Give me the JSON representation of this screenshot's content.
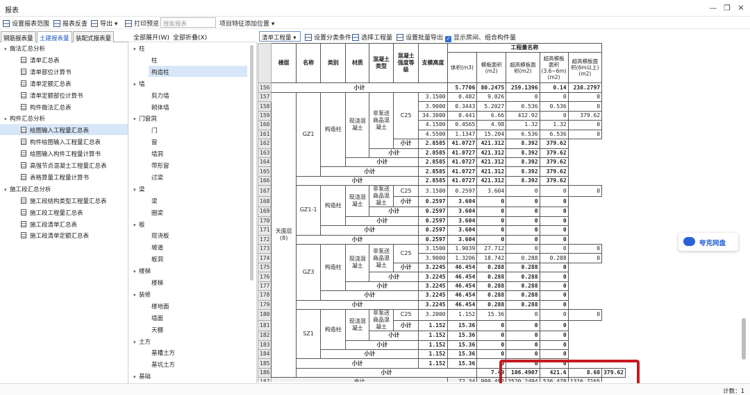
{
  "window": {
    "title": "报表"
  },
  "toolbar": {
    "set_range": "设置报表范围",
    "reverse_check": "报表反查",
    "export": "导出",
    "print_preview": "打印预览",
    "search_placeholder": "搜索报表",
    "add_position": "项目特征添加位置"
  },
  "left_tabs": [
    {
      "label": "钢筋报表量",
      "active": false
    },
    {
      "label": "土建报表量",
      "active": true
    },
    {
      "label": "装配式报表量",
      "active": false
    }
  ],
  "left_tree": [
    {
      "label": "做法汇总分析",
      "level": 0
    },
    {
      "label": "清单汇总表",
      "level": 1
    },
    {
      "label": "清单部位计算书",
      "level": 1
    },
    {
      "label": "清单定额汇总表",
      "level": 1
    },
    {
      "label": "清单定额部位计算书",
      "level": 1
    },
    {
      "label": "构件做法汇总表",
      "level": 1
    },
    {
      "label": "构件汇总分析",
      "level": 0
    },
    {
      "label": "绘图输入工程量汇总表",
      "level": 1,
      "selected": true
    },
    {
      "label": "构件绘图输入工程量汇总表",
      "level": 1
    },
    {
      "label": "绘图输入构件工程量计算书",
      "level": 1
    },
    {
      "label": "高强节点混凝土工程量汇总表",
      "level": 1
    },
    {
      "label": "表格算量工程量计算书",
      "level": 1
    },
    {
      "label": "施工段汇总分析",
      "level": 0
    },
    {
      "label": "施工段结构类型工程量汇总表",
      "level": 1
    },
    {
      "label": "施工段工程量汇总表",
      "level": 1
    },
    {
      "label": "施工段清单汇总表",
      "level": 1
    },
    {
      "label": "施工段清单定额汇总表",
      "level": 1
    }
  ],
  "mid_header": {
    "expand_all": "全部展开(W)",
    "collapse_all": "全部折叠(X)"
  },
  "mid_tree": [
    {
      "label": "柱",
      "level": 0
    },
    {
      "label": "柱",
      "level": 1
    },
    {
      "label": "构造柱",
      "level": 1,
      "selected": true
    },
    {
      "label": "墙",
      "level": 0
    },
    {
      "label": "剪力墙",
      "level": 1
    },
    {
      "label": "砌体墙",
      "level": 1
    },
    {
      "label": "门窗洞",
      "level": 0
    },
    {
      "label": "门",
      "level": 1
    },
    {
      "label": "窗",
      "level": 1
    },
    {
      "label": "墙洞",
      "level": 1
    },
    {
      "label": "带形窗",
      "level": 1
    },
    {
      "label": "过梁",
      "level": 1
    },
    {
      "label": "梁",
      "level": 0
    },
    {
      "label": "梁",
      "level": 1
    },
    {
      "label": "圈梁",
      "level": 1
    },
    {
      "label": "板",
      "level": 0
    },
    {
      "label": "现浇板",
      "level": 1
    },
    {
      "label": "坡道",
      "level": 1
    },
    {
      "label": "板洞",
      "level": 1
    },
    {
      "label": "楼梯",
      "level": 0
    },
    {
      "label": "楼梯",
      "level": 1
    },
    {
      "label": "装修",
      "level": 0
    },
    {
      "label": "楼地面",
      "level": 1
    },
    {
      "label": "墙面",
      "level": 1
    },
    {
      "label": "天棚",
      "level": 1
    },
    {
      "label": "土方",
      "level": 0
    },
    {
      "label": "基槽土方",
      "level": 1
    },
    {
      "label": "基坑土方",
      "level": 1
    },
    {
      "label": "基础",
      "level": 0
    }
  ],
  "right_toolbar": {
    "dropdown": "清单工程量",
    "set_classify": "设置分类条件",
    "select_qty": "选择工程量",
    "batch_export": "设置批量导出",
    "show_rooms": "显示房间、组合构件量"
  },
  "table": {
    "headers": {
      "floor": "楼层",
      "name": "名称",
      "category": "类别",
      "material": "材质",
      "concrete_type": "混凝土类型",
      "concrete_grade": "混凝土强度等级",
      "support_height": "支模高度",
      "qty_group": "工程量名称",
      "volume": "体积(m3)",
      "formwork": "模板面积(m2)",
      "over_formwork": "超高模板面积(m2)",
      "over_formwork_36": "超高模板面积(3.6~6m)(m2)",
      "over_formwork_6": "超高模板面积(6m以上)(m2)"
    },
    "floor_value": "天面层(8)",
    "subtotal": "小计",
    "total": "合计",
    "row_156": {
      "num": "156",
      "vals": [
        "5.7706",
        "80.2475",
        "259.1396",
        "0.14",
        "238.2797"
      ]
    },
    "gz1": {
      "name": "GZ1",
      "category": "构造柱",
      "material": "现浇混凝土",
      "ctype": "非泵送商品混凝土",
      "grade": "C25",
      "rows": [
        {
          "num": "157",
          "h": "3.1500",
          "vals": [
            "0.482",
            "9.026",
            "0",
            "0",
            "0"
          ]
        },
        {
          "num": "158",
          "h": "3.9000",
          "vals": [
            "0.3443",
            "5.2027",
            "0.536",
            "0.536",
            "0"
          ]
        },
        {
          "num": "159",
          "h": "34.3000",
          "vals": [
            "0.441",
            "6.66",
            "412.92",
            "0",
            "379.62"
          ]
        },
        {
          "num": "160",
          "h": "4.1500",
          "vals": [
            "0.4565",
            "4.98",
            "1.32",
            "1.32",
            "0"
          ]
        },
        {
          "num": "161",
          "h": "4.5500",
          "vals": [
            "1.1347",
            "15.204",
            "6.536",
            "6.536",
            "0"
          ]
        }
      ],
      "sub": [
        "2.8585",
        "41.0727",
        "421.312",
        "8.392",
        "379.62"
      ]
    },
    "gz1_1": {
      "name": "GZ1-1",
      "category": "构造柱",
      "material": "现浇混凝土",
      "ctype": "非泵送商品混凝土",
      "grade": "C25",
      "rows": [
        {
          "num": "167",
          "h": "3.1500",
          "vals": [
            "0.2597",
            "3.604",
            "0",
            "0",
            "0"
          ]
        }
      ],
      "sub": [
        "0.2597",
        "3.604",
        "0",
        "0",
        "0"
      ]
    },
    "gz3": {
      "name": "GZ3",
      "category": "构造柱",
      "material": "现浇混凝土",
      "ctype": "非泵送商品混凝土",
      "grade": "C25",
      "rows": [
        {
          "num": "173",
          "h": "3.1500",
          "vals": [
            "1.9039",
            "27.712",
            "0",
            "0",
            "0"
          ]
        },
        {
          "num": "174",
          "h": "3.9000",
          "vals": [
            "1.3206",
            "18.742",
            "0.288",
            "0.288",
            "0"
          ]
        }
      ],
      "sub": [
        "3.2245",
        "46.454",
        "0.288",
        "0.288",
        "0"
      ]
    },
    "sz1": {
      "name": "SZ1",
      "category": "构造柱",
      "material": "现浇混凝土",
      "ctype": "非泵送商品混凝土",
      "grade": "C25",
      "rows": [
        {
          "num": "180",
          "h": "3.2000",
          "vals": [
            "1.152",
            "15.36",
            "0",
            "0",
            "0"
          ]
        }
      ],
      "sub": [
        "1.152",
        "15.36",
        "0",
        "0",
        "0"
      ]
    },
    "row_186": {
      "num": "186",
      "vals": [
        "7.49",
        "106.4907",
        "421.6",
        "8.68",
        "379.62"
      ]
    },
    "row_187": {
      "num": "187",
      "vals": [
        "72.34",
        "999.482",
        "2520.2494",
        "536.478",
        "1316.7165"
      ]
    }
  },
  "cloud_widget": {
    "label": "夸克网盘"
  },
  "status": {
    "count": "计数：1"
  },
  "colors": {
    "accent": "#1d5bbf",
    "highlight": "#c8191f"
  }
}
